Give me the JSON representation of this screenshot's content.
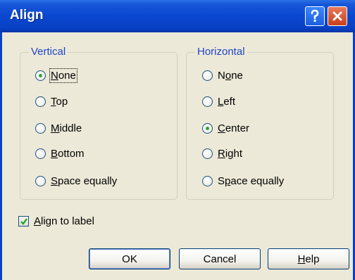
{
  "window": {
    "title": "Align"
  },
  "titlebar_buttons": {
    "help": "help-icon",
    "close": "close-icon"
  },
  "vertical": {
    "label": "Vertical",
    "options": [
      {
        "pre": "",
        "mn": "N",
        "post": "one",
        "checked": true
      },
      {
        "pre": "",
        "mn": "T",
        "post": "op",
        "checked": false
      },
      {
        "pre": "",
        "mn": "M",
        "post": "iddle",
        "checked": false
      },
      {
        "pre": "",
        "mn": "B",
        "post": "ottom",
        "checked": false
      },
      {
        "pre": "",
        "mn": "S",
        "post": "pace equally",
        "checked": false
      }
    ]
  },
  "horizontal": {
    "label": "Horizontal",
    "options": [
      {
        "pre": "N",
        "mn": "o",
        "post": "ne",
        "checked": false
      },
      {
        "pre": "",
        "mn": "L",
        "post": "eft",
        "checked": false
      },
      {
        "pre": "",
        "mn": "C",
        "post": "enter",
        "checked": true
      },
      {
        "pre": "",
        "mn": "R",
        "post": "ight",
        "checked": false
      },
      {
        "pre": "S",
        "mn": "p",
        "post": "ace equally",
        "checked": false
      }
    ]
  },
  "align_to_label": {
    "mn": "A",
    "post": "lign to label",
    "checked": true
  },
  "buttons": {
    "ok": "OK",
    "cancel": "Cancel",
    "help_mn": "H",
    "help_post": "elp"
  },
  "colors": {
    "title_bar": "#0a47d0",
    "group_label": "#1f44c6",
    "radio_dot": "#2fa33a"
  }
}
